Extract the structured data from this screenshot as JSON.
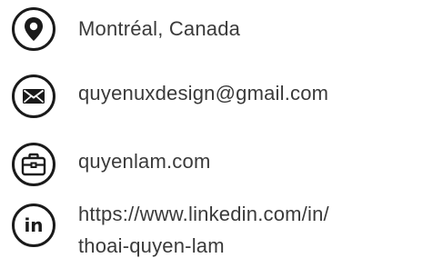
{
  "contacts": {
    "location": {
      "icon": "location-pin-icon",
      "text": "Montréal, Canada"
    },
    "email": {
      "icon": "envelope-icon",
      "text": "quyenuxdesign@gmail.com"
    },
    "website": {
      "icon": "briefcase-icon",
      "text": "quyenlam.com"
    },
    "linkedin": {
      "icon": "linkedin-icon",
      "icon_text": "in",
      "text_line1": "https://www.linkedin.com/in/",
      "text_line2": "thoai-quyen-lam"
    }
  },
  "colors": {
    "icon": "#1a1a1a",
    "text": "#3a3a3a",
    "background": "#ffffff"
  }
}
